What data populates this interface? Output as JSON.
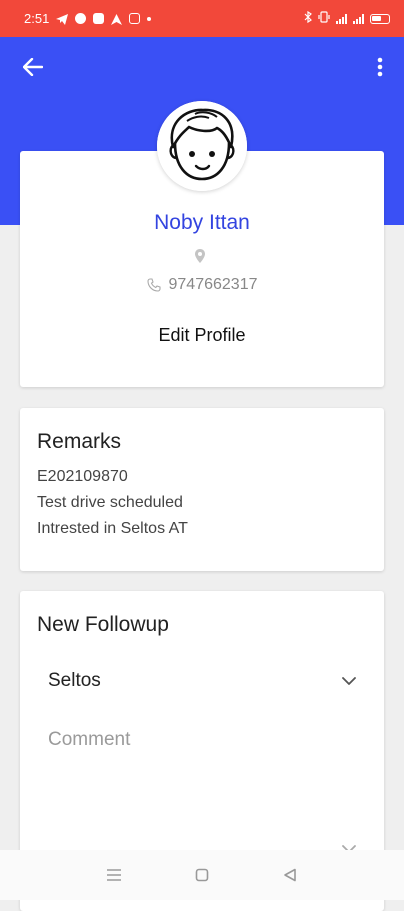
{
  "status_bar": {
    "time": "2:51",
    "notification_icons": [
      "telegram-icon",
      "chat-icon",
      "app-icon",
      "navigation-icon",
      "instagram-icon",
      "dot-icon"
    ],
    "system_icons": [
      "bluetooth-icon",
      "vibrate-icon",
      "signal-icon",
      "signal-icon",
      "battery-icon"
    ],
    "background_color": "#f2483a"
  },
  "header": {
    "background_color": "#3a50f5",
    "back_icon": "arrow-left-icon",
    "menu_icon": "more-vertical-icon"
  },
  "profile": {
    "name": "Noby Ittan",
    "phone": "9747662317",
    "edit_label": "Edit Profile",
    "name_color": "#3344e0"
  },
  "remarks": {
    "title": "Remarks",
    "lines": [
      "E202109870",
      "Test drive scheduled",
      "Intrested in Seltos AT"
    ]
  },
  "followup": {
    "title": "New Followup",
    "vehicle_value": "Seltos",
    "comment_placeholder": "Comment"
  },
  "nav": {
    "icons": [
      "menu-icon",
      "home-icon",
      "back-icon"
    ]
  }
}
